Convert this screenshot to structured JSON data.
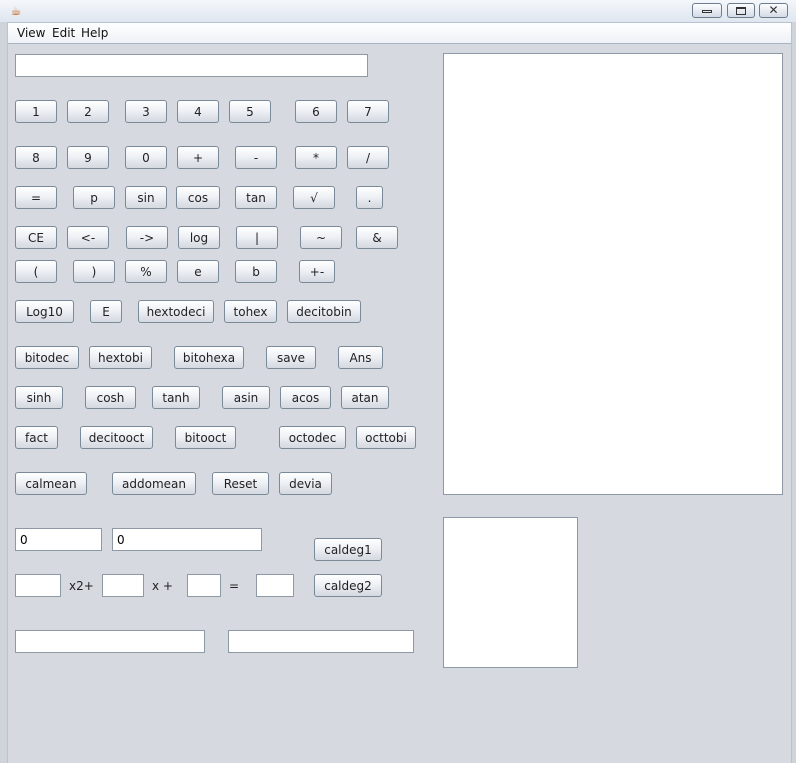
{
  "window": {
    "app_icon": "java-cup-icon",
    "controls": [
      "minimize-icon",
      "maximize-icon",
      "close-icon"
    ]
  },
  "menu": {
    "items": [
      "View",
      "Edit",
      "Help"
    ]
  },
  "display": {
    "value": ""
  },
  "keypad": {
    "row1": [
      "1",
      "2",
      "3",
      "4",
      "5",
      "6",
      "7"
    ],
    "row2": [
      "8",
      "9",
      "0",
      "+",
      "-",
      "*",
      "/"
    ],
    "row3": [
      "=",
      "p",
      "sin",
      "cos",
      "tan",
      "√",
      "."
    ],
    "row4": [
      "CE",
      "<-",
      "->",
      "log",
      "|",
      "~",
      "&"
    ],
    "row5": [
      "(",
      ")",
      "%",
      "e",
      "b",
      "+-"
    ],
    "row6": [
      "Log10",
      "E",
      "hextodeci",
      "tohex",
      "decitobin"
    ],
    "row7": [
      "bitodec",
      "hextobi",
      "bitohexa",
      "save",
      "Ans"
    ],
    "row8": [
      "sinh",
      "cosh",
      "tanh",
      "asin",
      "acos",
      "atan"
    ],
    "row9": [
      "fact",
      "decitooct",
      "bitooct",
      "octodec",
      "octtobi"
    ],
    "row10": [
      "calmean",
      "addomean",
      "Reset",
      "devia"
    ]
  },
  "linear": {
    "input1": "0",
    "input2": "0",
    "button": "caldeg1"
  },
  "quadratic": {
    "a": "",
    "b": "",
    "c": "",
    "result": "",
    "label_x2": "x2+",
    "label_x": "x +",
    "label_eq": "=",
    "button": "caldeg2"
  },
  "outputs": {
    "out1": "",
    "out2": ""
  }
}
